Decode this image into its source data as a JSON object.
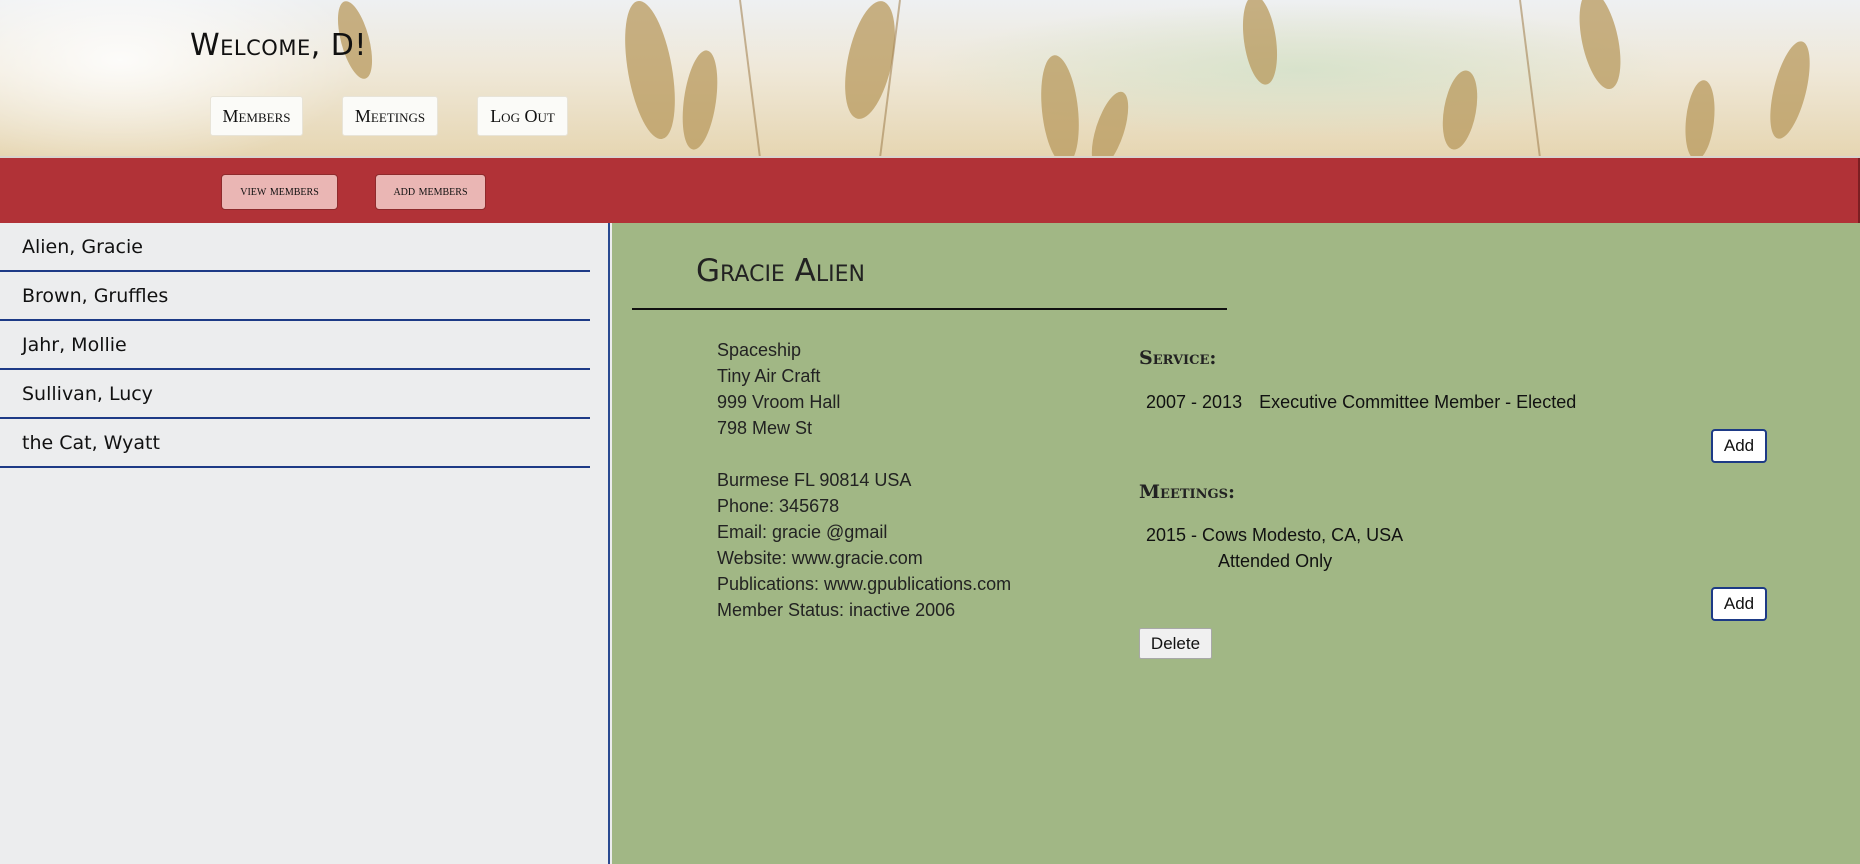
{
  "header": {
    "welcome": "Welcome, D!",
    "nav": {
      "members": "Members",
      "meetings": "Meetings",
      "logout": "Log Out"
    }
  },
  "subnav": {
    "view_members": "view members",
    "add_members": "add members"
  },
  "colors": {
    "subnav_bg": "#b13237",
    "main_bg": "#a1b785",
    "sidebar_bg": "#ecedee",
    "accent_blue": "#1d3a86"
  },
  "sidebar": {
    "members": [
      {
        "label": "Alien, Gracie"
      },
      {
        "label": "Brown, Gruffles"
      },
      {
        "label": "Jahr, Mollie"
      },
      {
        "label": "Sullivan, Lucy"
      },
      {
        "label": "the Cat, Wyatt"
      }
    ]
  },
  "member": {
    "name": "Gracie Alien",
    "address_lines": [
      "Spaceship",
      "Tiny Air Craft",
      "999 Vroom Hall",
      "798 Mew St"
    ],
    "city_line": "Burmese FL 90814 USA",
    "phone": "Phone: 345678",
    "email": "Email: gracie @gmail",
    "website": "Website: www.gracie.com",
    "publications": "Publications: www.gpublications.com",
    "status": "Member Status: inactive 2006"
  },
  "service": {
    "heading": "Service:",
    "entries": [
      {
        "years": "2007 - 2013",
        "role": "Executive Committee Member - Elected"
      }
    ],
    "add_label": "Add"
  },
  "meetings": {
    "heading": "Meetings:",
    "entries": [
      {
        "line1": "2015 - Cows Modesto, CA, USA",
        "line2": "Attended Only"
      }
    ],
    "add_label": "Add"
  },
  "delete_label": "Delete"
}
